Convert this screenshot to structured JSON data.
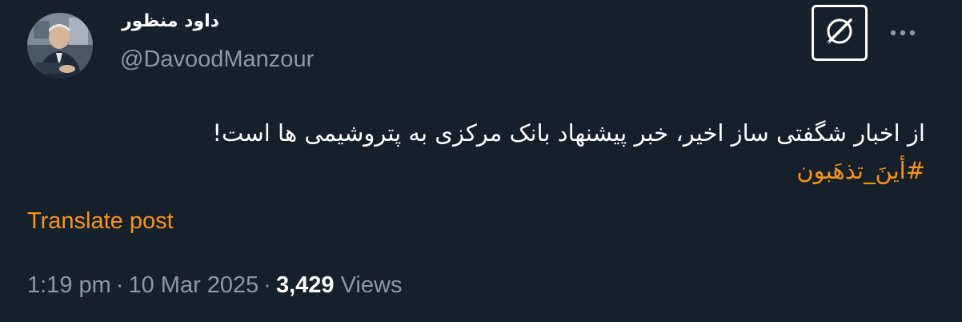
{
  "author": {
    "display_name": "داود منظور",
    "handle": "@DavoodManzour"
  },
  "post": {
    "text": "از اخبار شگفتی ساز اخیر، خبر پیشنهاد بانک مرکزی به پتروشیمی ها است!",
    "hashtag": "#أينَ_تذهَبون",
    "translate_label": "Translate post"
  },
  "meta": {
    "time": "1:19 pm",
    "separator": "·",
    "date": "10 Mar 2025",
    "views_count": "3,429",
    "views_label": "Views"
  },
  "icons": {
    "grok": "grok-icon",
    "more": "more-horizontal-icon",
    "avatar": "avatar"
  },
  "colors": {
    "background": "#15202b",
    "accent": "#f7931a",
    "secondary_text": "#8b98a5",
    "primary_text": "#ffffff"
  }
}
